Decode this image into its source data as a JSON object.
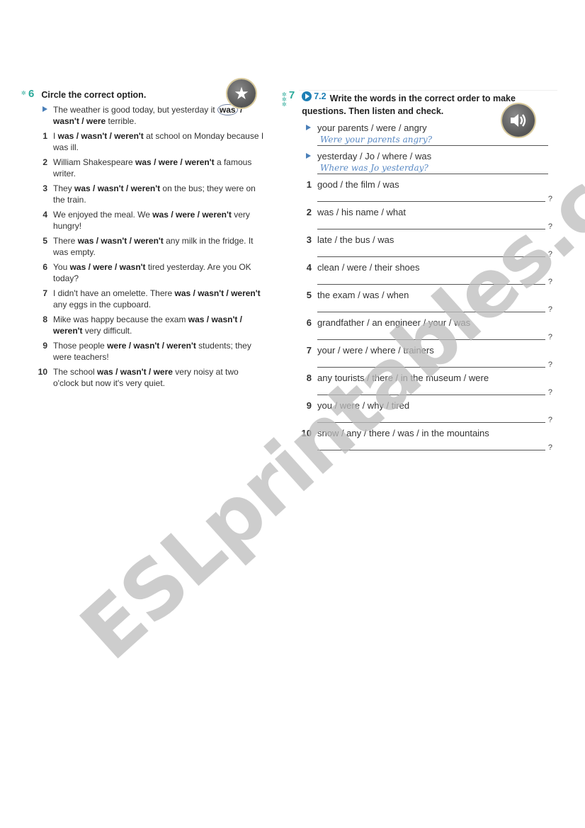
{
  "exercise6": {
    "number": "6",
    "stars": "✲",
    "title": "Circle the correct option.",
    "badge_icon": "star-icon",
    "example": {
      "pre": "The weather is good today, but yesterday it ",
      "circled": "was",
      "options_rest": " / wasn't / were",
      "post": " terrible."
    },
    "items": [
      {
        "num": "1",
        "pre": "I ",
        "options": "was / wasn't / weren't",
        "post": " at school on Monday because I was ill."
      },
      {
        "num": "2",
        "pre": "William Shakespeare ",
        "options": "was / were / weren't",
        "post": " a famous writer."
      },
      {
        "num": "3",
        "pre": "They ",
        "options": "was / wasn't / weren't",
        "post": " on the bus; they were on the train."
      },
      {
        "num": "4",
        "pre": "We enjoyed the meal. We ",
        "options": "was / were / weren't",
        "post": " very hungry!"
      },
      {
        "num": "5",
        "pre": "There ",
        "options": "was / wasn't / weren't",
        "post": " any milk in the fridge. It was empty."
      },
      {
        "num": "6",
        "pre": "You ",
        "options": "was / were / wasn't",
        "post": " tired yesterday. Are you OK today?"
      },
      {
        "num": "7",
        "pre": "I didn't have an omelette. There ",
        "options": "was / wasn't / weren't",
        "post": " any eggs in the cupboard."
      },
      {
        "num": "8",
        "pre": "Mike was happy because the exam ",
        "options": "was / wasn't / weren't",
        "post": " very difficult."
      },
      {
        "num": "9",
        "pre": "Those people ",
        "options": "were / wasn't / weren't",
        "post": " students; they were teachers!"
      },
      {
        "num": "10",
        "pre": "The school ",
        "options": "was / wasn't / were",
        "post": " very noisy at two o'clock but now it's very quiet."
      }
    ]
  },
  "exercise7": {
    "number": "7",
    "stars": "✲✲✲",
    "audio_track": "7.2",
    "title": "Write the words in the correct order to make questions. Then listen and check.",
    "badge_icon": "speaker-icon",
    "examples": [
      {
        "prompt": "your parents / were / angry",
        "answer": "Were your parents angry?"
      },
      {
        "prompt": "yesterday / Jo / where / was",
        "answer": "Where was Jo yesterday?"
      }
    ],
    "items": [
      {
        "num": "1",
        "prompt": "good / the film / was",
        "end": "?"
      },
      {
        "num": "2",
        "prompt": "was / his name / what",
        "end": "?"
      },
      {
        "num": "3",
        "prompt": "late / the bus / was",
        "end": "?"
      },
      {
        "num": "4",
        "prompt": "clean / were /  their shoes",
        "end": "?"
      },
      {
        "num": "5",
        "prompt": "the exam / was / when",
        "end": "?"
      },
      {
        "num": "6",
        "prompt": "grandfather / an engineer / your / was",
        "end": "?"
      },
      {
        "num": "7",
        "prompt": "your / were / where / trainers",
        "end": "?"
      },
      {
        "num": "8",
        "prompt": "any tourists / there / in the museum / were",
        "end": "?"
      },
      {
        "num": "9",
        "prompt": "you / were / why / tired",
        "end": "?"
      },
      {
        "num": "10",
        "prompt": "snow / any / there / was / in the mountains",
        "end": "?"
      }
    ]
  },
  "watermark": "ESLprintables.com"
}
